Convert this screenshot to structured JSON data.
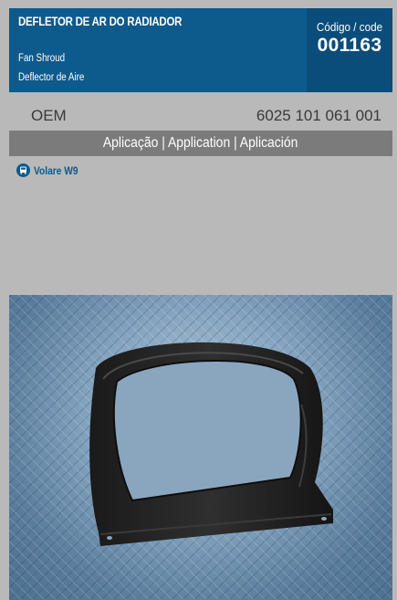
{
  "product": {
    "title": "DEFLETOR DE AR DO RADIADOR",
    "subtitle_en": "Fan Shroud",
    "subtitle_es": "Deflector de Aire"
  },
  "code": {
    "label": "Código / code",
    "value": "001163"
  },
  "oem": {
    "label": "OEM",
    "value": "6025 101 061 001"
  },
  "application": {
    "header": "Aplicação | Application | Aplicación",
    "items": [
      {
        "icon": "bus-icon",
        "label": "Volare W9"
      }
    ]
  },
  "colors": {
    "header_blue": "#0d5a8c",
    "code_blue": "#0a4d7b",
    "background_gray": "#b9b9b9",
    "bar_gray": "#7b7b7b"
  }
}
